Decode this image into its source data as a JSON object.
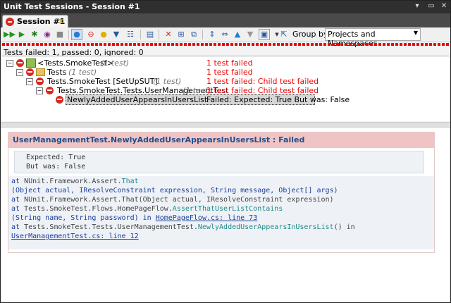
{
  "window": {
    "title": "Unit Test Sessions - Session #1"
  },
  "tab": {
    "label": "Session #1"
  },
  "toolbar": {
    "group_by_label": "Group by:",
    "group_by_value": "Projects and Namespaces"
  },
  "status": {
    "summary": "Tests failed: 1, passed: 0, ignored: 0"
  },
  "tree": {
    "rows": [
      {
        "name": "<Tests.SmokeTest>",
        "count": "(1 test)",
        "result": "1 test failed"
      },
      {
        "name": "Tests",
        "count": "(1 test)",
        "result": "1 test failed"
      },
      {
        "name": "Tests.SmokeTest [SetUpSUT]",
        "count": "(1 test)",
        "result": "1 test failed: Child test failed"
      },
      {
        "name": "Tests.SmokeTest.Tests.UserManagementTest",
        "count": "(1 test)",
        "result": "1 test failed: Child test failed"
      },
      {
        "name": "NewlyAddedUserAppearsInUsersList",
        "count": "",
        "result": "Failed:  Expected: True But was: False"
      }
    ]
  },
  "detail": {
    "title": "UserManagementTest.NewlyAddedUserAppearsInUsersList : Failed",
    "expected": "Expected: True",
    "actual": "But was:  False",
    "stack": {
      "l1_at": "at",
      "l1_ns": "NUnit.Framework.Assert.",
      "l1_m": "That",
      "l2": "(Object actual, IResolveConstraint expression, String message, Object[] args)",
      "l3_at": "at",
      "l3": "NUnit.Framework.Assert.That(Object actual, IResolveConstraint expression)",
      "l4_at": "at",
      "l4_ns": "Tests.SmokeTest.Flows.HomePageFlow.",
      "l4_m": "AssertThatUserListContains",
      "l5": "(String name, String password) in",
      "l5_link": "HomePageFlow.cs: line 73",
      "l6_at": "at",
      "l6_ns": "Tests.SmokeTest.Tests.UserManagementTest.",
      "l6_m": "NewlyAddedUserAppearsInUsersList",
      "l6_tail": "() in",
      "l7_link": "UserManagementTest.cs: line 12"
    }
  },
  "colors": {
    "fail": "#e00000",
    "header_bg": "#f0c4c4",
    "link": "#1a3f9a"
  }
}
